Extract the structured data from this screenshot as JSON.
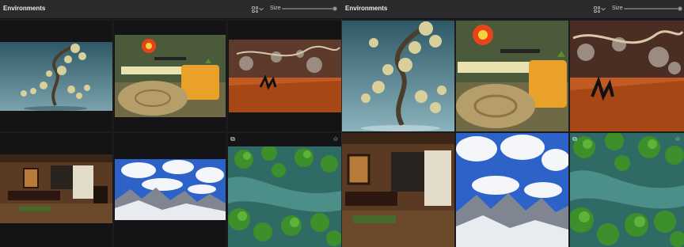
{
  "left_panel": {
    "title": "Environments",
    "size_label": "Size",
    "slider_value_fraction": 0.98
  },
  "right_panel": {
    "title": "Environments",
    "size_label": "Size",
    "slider_value_fraction": 0.98
  },
  "icons": {
    "view_toggle": "grid-icon",
    "dropdown": "chevron-down-icon",
    "copy": "copy-icon",
    "favorite": "star-icon"
  },
  "colors": {
    "header": "#2a2a2c",
    "panel": "#1c1c1e",
    "text": "#ededed"
  }
}
